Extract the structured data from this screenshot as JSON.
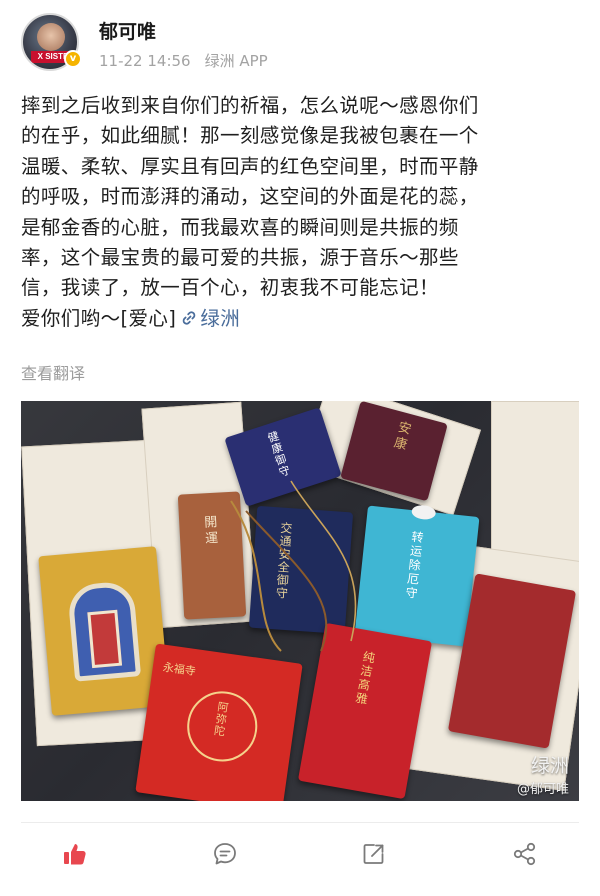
{
  "post": {
    "author": {
      "name": "郁可唯",
      "avatar_badge": "X SISTE",
      "verified_color": "#f5b400"
    },
    "time": "11-22 14:56",
    "source": "绿洲 APP",
    "lines": [
      "摔到之后收到来自你们的祈福，怎么说呢～感恩你们",
      "的在乎，如此细腻！那一刻感觉像是我被包裹在一个",
      "温暖、柔软、厚实且有回声的红色空间里，时而平静",
      "的呼吸，时而澎湃的涌动，这空间的外面是花的蕊，",
      "是郁金香的心脏，而我最欢喜的瞬间则是共振的频",
      "率，这个最宝贵的最可爱的共振，源于音乐～那些",
      "信，我读了，放一百个心，初衷我不可能忘记！"
    ],
    "last_line": "爱你们哟～[爱心]",
    "link_label": "绿洲",
    "link_color": "#4a6d9b",
    "translate": "查看翻译"
  },
  "photo": {
    "amulets": {
      "yellow": "",
      "brown": "開運",
      "navy_top": "健康御守",
      "navy_main": "交通安全御守",
      "teal": "转运除厄守",
      "purple": "安康",
      "red_left": "阿弥陀",
      "red_left_top": "永福寺",
      "red_right": "纯洁高雅"
    },
    "watermark_logo": "绿洲",
    "watermark_user": "@郁可唯"
  },
  "actions": {
    "like_icon": "thumbs-up-icon",
    "comment_icon": "comment-icon",
    "repost_icon": "repost-icon",
    "share_icon": "share-icon",
    "like_color": "#e8474f",
    "icon_color": "#7a7a7a"
  }
}
